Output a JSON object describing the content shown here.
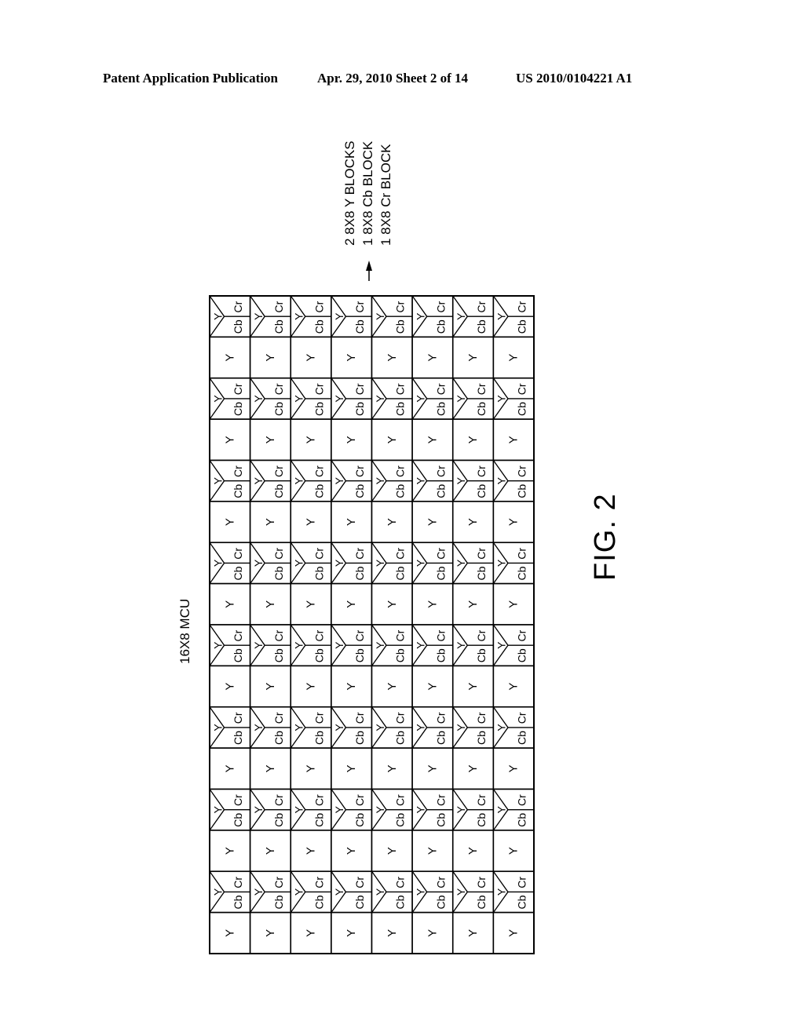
{
  "header": {
    "left": "Patent Application Publication",
    "middle": "Apr. 29, 2010  Sheet 2 of 14",
    "right": "US 2010/0104221 A1"
  },
  "figure": {
    "label": "FIG. 2",
    "mcu_label": "16X8 MCU",
    "output_lines": [
      "2 8X8 Y BLOCKS",
      "1 8X8 Cb BLOCK",
      "1 8X8 Cr BLOCK"
    ],
    "grid": {
      "columns": 8,
      "rows": 16,
      "row_pattern": [
        "YCbCr",
        "Y"
      ],
      "cell_labels": {
        "y": "Y",
        "cb": "Cb",
        "cr": "Cr"
      }
    }
  }
}
